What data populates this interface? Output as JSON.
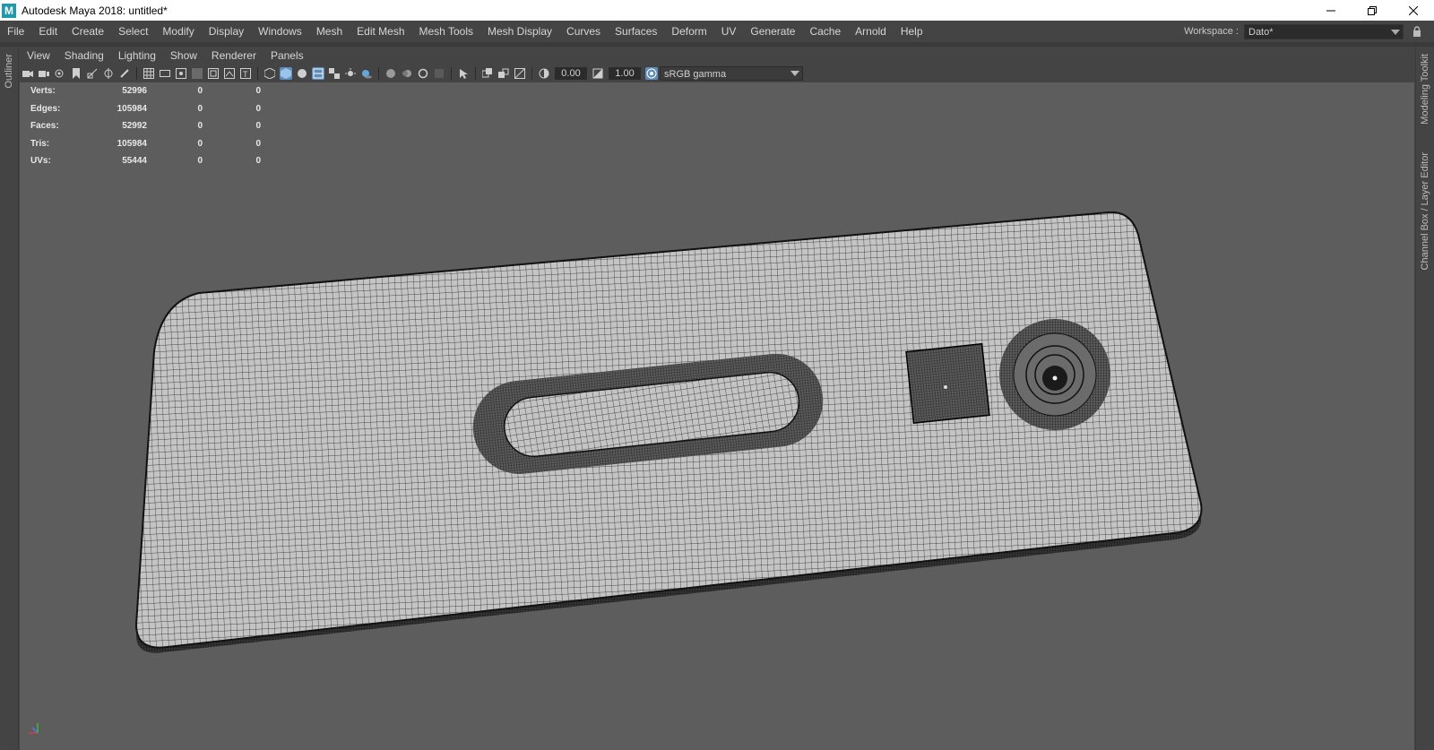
{
  "window": {
    "title": "Autodesk Maya 2018: untitled*",
    "logo_letter": "M"
  },
  "menu": [
    "File",
    "Edit",
    "Create",
    "Select",
    "Modify",
    "Display",
    "Windows",
    "Mesh",
    "Edit Mesh",
    "Mesh Tools",
    "Mesh Display",
    "Curves",
    "Surfaces",
    "Deform",
    "UV",
    "Generate",
    "Cache",
    "Arnold",
    "Help"
  ],
  "workspace": {
    "label": "Workspace :",
    "value": "Dato*"
  },
  "side_tabs": {
    "left": "Outliner",
    "right_top": "Modeling Toolkit",
    "right_bottom": "Channel Box / Layer Editor"
  },
  "panel_menu": [
    "View",
    "Shading",
    "Lighting",
    "Show",
    "Renderer",
    "Panels"
  ],
  "toolbar": {
    "exposure": "0.00",
    "gamma": "1.00",
    "color_space": "sRGB gamma"
  },
  "hud": [
    {
      "label": "Verts:",
      "v1": "52996",
      "v2": "0",
      "v3": "0"
    },
    {
      "label": "Edges:",
      "v1": "105984",
      "v2": "0",
      "v3": "0"
    },
    {
      "label": "Faces:",
      "v1": "52992",
      "v2": "0",
      "v3": "0"
    },
    {
      "label": "Tris:",
      "v1": "105984",
      "v2": "0",
      "v3": "0"
    },
    {
      "label": "UVs:",
      "v1": "55444",
      "v2": "0",
      "v3": "0"
    }
  ],
  "colors": {
    "ui_bg": "#444444",
    "viewport_bg": "#5d5d5d",
    "accent": "#5e8dbb"
  }
}
